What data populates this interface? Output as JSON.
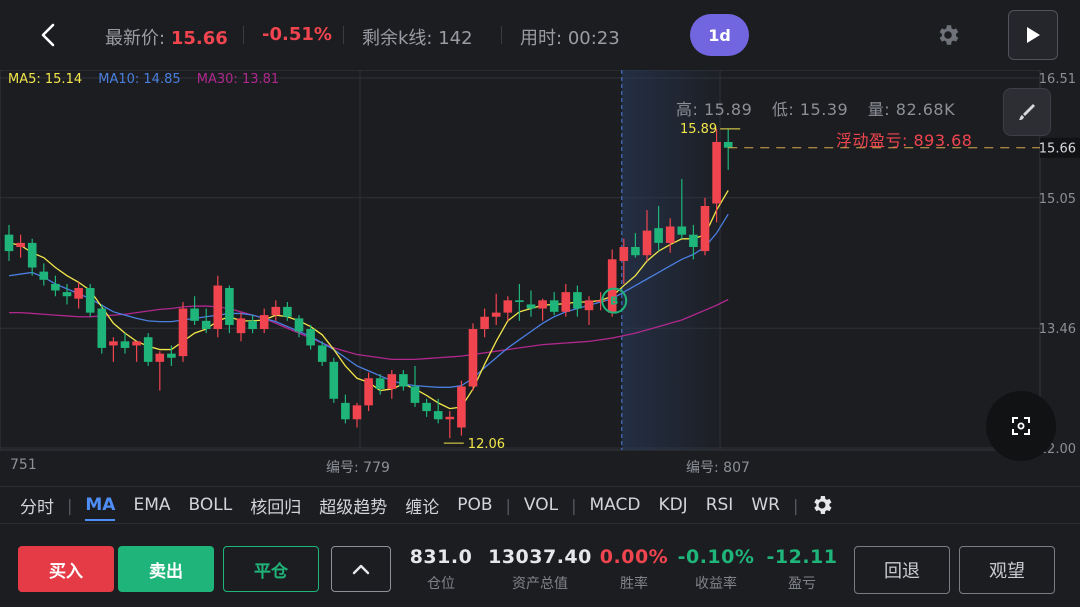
{
  "topbar": {
    "price_label": "最新价:",
    "price_value": "15.66",
    "change_pct": "-0.51%",
    "remaining_label": "剩余k线:",
    "remaining_value": "142",
    "time_label": "用时:",
    "time_value": "00:23",
    "period": "1d"
  },
  "ma_legend": {
    "ma5": "MA5: 15.14",
    "ma10": "MA10: 14.85",
    "ma30": "MA30: 13.81"
  },
  "hl_info": {
    "high": "高: 15.89",
    "low": "低: 15.39",
    "volume": "量: 82.68K"
  },
  "floating_pnl": "浮动盈亏: 893.68",
  "chart_data": {
    "type": "candlestick",
    "y_ticks": [
      "16.51",
      "15.05",
      "13.46",
      "12.00"
    ],
    "ylim": [
      12.0,
      16.51
    ],
    "current_price_tag": "15.66",
    "high_marker": "15.89",
    "low_marker": "12.06",
    "buy_marker": "B",
    "x_labels": [
      "751",
      "编号: 779",
      "编号: 807"
    ],
    "candles": [
      {
        "o": 14.6,
        "h": 14.72,
        "l": 14.28,
        "c": 14.4
      },
      {
        "o": 14.45,
        "h": 14.6,
        "l": 14.32,
        "c": 14.5
      },
      {
        "o": 14.5,
        "h": 14.55,
        "l": 14.1,
        "c": 14.2
      },
      {
        "o": 14.15,
        "h": 14.25,
        "l": 13.98,
        "c": 14.05
      },
      {
        "o": 14.0,
        "h": 14.1,
        "l": 13.85,
        "c": 13.92
      },
      {
        "o": 13.9,
        "h": 14.0,
        "l": 13.75,
        "c": 13.85
      },
      {
        "o": 13.82,
        "h": 14.02,
        "l": 13.7,
        "c": 13.95
      },
      {
        "o": 13.95,
        "h": 14.0,
        "l": 13.6,
        "c": 13.65
      },
      {
        "o": 13.7,
        "h": 13.75,
        "l": 13.15,
        "c": 13.22
      },
      {
        "o": 13.25,
        "h": 13.35,
        "l": 13.05,
        "c": 13.3
      },
      {
        "o": 13.3,
        "h": 13.4,
        "l": 13.15,
        "c": 13.22
      },
      {
        "o": 13.25,
        "h": 13.3,
        "l": 13.05,
        "c": 13.3
      },
      {
        "o": 13.35,
        "h": 13.4,
        "l": 13.0,
        "c": 13.05
      },
      {
        "o": 13.05,
        "h": 13.18,
        "l": 12.7,
        "c": 13.15
      },
      {
        "o": 13.15,
        "h": 13.25,
        "l": 13.0,
        "c": 13.1
      },
      {
        "o": 13.12,
        "h": 13.78,
        "l": 13.05,
        "c": 13.7
      },
      {
        "o": 13.7,
        "h": 13.85,
        "l": 13.5,
        "c": 13.55
      },
      {
        "o": 13.55,
        "h": 13.7,
        "l": 13.4,
        "c": 13.45
      },
      {
        "o": 13.45,
        "h": 14.1,
        "l": 13.35,
        "c": 13.98
      },
      {
        "o": 13.95,
        "h": 13.98,
        "l": 13.4,
        "c": 13.5
      },
      {
        "o": 13.4,
        "h": 13.65,
        "l": 13.3,
        "c": 13.58
      },
      {
        "o": 13.55,
        "h": 13.62,
        "l": 13.4,
        "c": 13.45
      },
      {
        "o": 13.45,
        "h": 13.7,
        "l": 13.4,
        "c": 13.62
      },
      {
        "o": 13.62,
        "h": 13.8,
        "l": 13.55,
        "c": 13.72
      },
      {
        "o": 13.72,
        "h": 13.78,
        "l": 13.55,
        "c": 13.6
      },
      {
        "o": 13.58,
        "h": 13.62,
        "l": 13.35,
        "c": 13.42
      },
      {
        "o": 13.45,
        "h": 13.5,
        "l": 13.2,
        "c": 13.25
      },
      {
        "o": 13.25,
        "h": 13.3,
        "l": 13.0,
        "c": 13.05
      },
      {
        "o": 13.05,
        "h": 13.1,
        "l": 12.55,
        "c": 12.6
      },
      {
        "o": 12.55,
        "h": 12.65,
        "l": 12.3,
        "c": 12.35
      },
      {
        "o": 12.35,
        "h": 12.55,
        "l": 12.25,
        "c": 12.52
      },
      {
        "o": 12.52,
        "h": 12.92,
        "l": 12.45,
        "c": 12.85
      },
      {
        "o": 12.85,
        "h": 12.9,
        "l": 12.65,
        "c": 12.72
      },
      {
        "o": 12.72,
        "h": 12.95,
        "l": 12.6,
        "c": 12.9
      },
      {
        "o": 12.9,
        "h": 12.95,
        "l": 12.7,
        "c": 12.75
      },
      {
        "o": 12.75,
        "h": 13.0,
        "l": 12.5,
        "c": 12.55
      },
      {
        "o": 12.55,
        "h": 12.6,
        "l": 12.38,
        "c": 12.45
      },
      {
        "o": 12.45,
        "h": 12.6,
        "l": 12.3,
        "c": 12.35
      },
      {
        "o": 12.35,
        "h": 12.45,
        "l": 12.12,
        "c": 12.38
      },
      {
        "o": 12.25,
        "h": 12.82,
        "l": 12.15,
        "c": 12.75
      },
      {
        "o": 12.75,
        "h": 13.52,
        "l": 12.7,
        "c": 13.45
      },
      {
        "o": 13.45,
        "h": 13.7,
        "l": 13.35,
        "c": 13.6
      },
      {
        "o": 13.6,
        "h": 13.88,
        "l": 13.5,
        "c": 13.65
      },
      {
        "o": 13.65,
        "h": 13.85,
        "l": 13.55,
        "c": 13.8
      },
      {
        "o": 13.8,
        "h": 14.0,
        "l": 13.55,
        "c": 13.78
      },
      {
        "o": 13.75,
        "h": 13.92,
        "l": 13.6,
        "c": 13.7
      },
      {
        "o": 13.7,
        "h": 13.82,
        "l": 13.55,
        "c": 13.8
      },
      {
        "o": 13.8,
        "h": 13.9,
        "l": 13.62,
        "c": 13.66
      },
      {
        "o": 13.66,
        "h": 14.0,
        "l": 13.6,
        "c": 13.9
      },
      {
        "o": 13.9,
        "h": 13.98,
        "l": 13.6,
        "c": 13.7
      },
      {
        "o": 13.68,
        "h": 13.85,
        "l": 13.5,
        "c": 13.8
      },
      {
        "o": 13.78,
        "h": 13.9,
        "l": 13.68,
        "c": 13.8
      },
      {
        "o": 13.65,
        "h": 14.42,
        "l": 13.6,
        "c": 14.3
      },
      {
        "o": 14.28,
        "h": 14.55,
        "l": 14.0,
        "c": 14.45
      },
      {
        "o": 14.45,
        "h": 14.62,
        "l": 14.32,
        "c": 14.35
      },
      {
        "o": 14.35,
        "h": 14.9,
        "l": 14.28,
        "c": 14.65
      },
      {
        "o": 14.68,
        "h": 14.95,
        "l": 14.4,
        "c": 14.5
      },
      {
        "o": 14.5,
        "h": 14.8,
        "l": 14.38,
        "c": 14.7
      },
      {
        "o": 14.7,
        "h": 15.28,
        "l": 14.55,
        "c": 14.6
      },
      {
        "o": 14.6,
        "h": 14.72,
        "l": 14.3,
        "c": 14.45
      },
      {
        "o": 14.4,
        "h": 15.05,
        "l": 14.35,
        "c": 14.95
      },
      {
        "o": 14.98,
        "h": 15.89,
        "l": 14.75,
        "c": 15.73
      },
      {
        "o": 15.73,
        "h": 15.89,
        "l": 15.39,
        "c": 15.66
      }
    ],
    "ma5": [
      14.5,
      14.47,
      14.38,
      14.32,
      14.2,
      14.1,
      14.02,
      13.92,
      13.72,
      13.52,
      13.4,
      13.3,
      13.24,
      13.2,
      13.2,
      13.3,
      13.4,
      13.45,
      13.55,
      13.6,
      13.55,
      13.55,
      13.56,
      13.62,
      13.6,
      13.55,
      13.48,
      13.38,
      13.2,
      13.0,
      12.85,
      12.8,
      12.7,
      12.72,
      12.78,
      12.72,
      12.64,
      12.55,
      12.48,
      12.5,
      12.72,
      13.02,
      13.3,
      13.55,
      13.66,
      13.7,
      13.74,
      13.75,
      13.76,
      13.78,
      13.78,
      13.8,
      13.85,
      13.98,
      14.1,
      14.28,
      14.4,
      14.48,
      14.55,
      14.55,
      14.6,
      14.9,
      15.14
    ],
    "ma10": [
      14.1,
      14.12,
      14.14,
      14.08,
      14.0,
      13.94,
      13.88,
      13.82,
      13.74,
      13.66,
      13.62,
      13.58,
      13.55,
      13.54,
      13.54,
      13.56,
      13.58,
      13.6,
      13.62,
      13.64,
      13.64,
      13.62,
      13.58,
      13.54,
      13.48,
      13.42,
      13.36,
      13.28,
      13.2,
      13.1,
      13.0,
      12.94,
      12.88,
      12.82,
      12.78,
      12.76,
      12.75,
      12.74,
      12.74,
      12.76,
      12.85,
      12.98,
      13.1,
      13.22,
      13.32,
      13.42,
      13.52,
      13.6,
      13.66,
      13.7,
      13.74,
      13.78,
      13.82,
      13.9,
      13.98,
      14.06,
      14.14,
      14.22,
      14.3,
      14.36,
      14.45,
      14.62,
      14.85
    ],
    "ma30": [
      13.65,
      13.65,
      13.64,
      13.63,
      13.62,
      13.61,
      13.6,
      13.6,
      13.61,
      13.62,
      13.63,
      13.65,
      13.67,
      13.69,
      13.7,
      13.72,
      13.73,
      13.73,
      13.72,
      13.7,
      13.66,
      13.62,
      13.58,
      13.52,
      13.46,
      13.4,
      13.34,
      13.28,
      13.22,
      13.18,
      13.14,
      13.12,
      13.1,
      13.08,
      13.08,
      13.08,
      13.09,
      13.1,
      13.11,
      13.12,
      13.14,
      13.16,
      13.18,
      13.2,
      13.22,
      13.24,
      13.26,
      13.27,
      13.28,
      13.29,
      13.3,
      13.32,
      13.34,
      13.37,
      13.4,
      13.44,
      13.48,
      13.52,
      13.56,
      13.62,
      13.68,
      13.74,
      13.81
    ]
  },
  "indicators": {
    "tabs": [
      "分时",
      "MA",
      "EMA",
      "BOLL",
      "核回归",
      "超级趋势",
      "缠论",
      "POB",
      "VOL",
      "MACD",
      "KDJ",
      "RSI",
      "WR"
    ],
    "active": "MA"
  },
  "bottom": {
    "buy": "买入",
    "sell": "卖出",
    "close": "平仓",
    "position_value": "831.0",
    "position_label": "仓位",
    "assets_value": "13037.40",
    "assets_label": "资产总值",
    "winrate_value": "0.00%",
    "winrate_label": "胜率",
    "return_value": "-0.10%",
    "return_label": "收益率",
    "pnl_value": "-12.11",
    "pnl_label": "盈亏",
    "backtest": "回退",
    "watch": "观望"
  },
  "colors": {
    "up": "#f0454f",
    "down": "#1fb57a",
    "ma5": "#f2e64a",
    "ma10": "#4a7fe0",
    "ma30": "#b0288e",
    "accent": "#7266e0"
  }
}
